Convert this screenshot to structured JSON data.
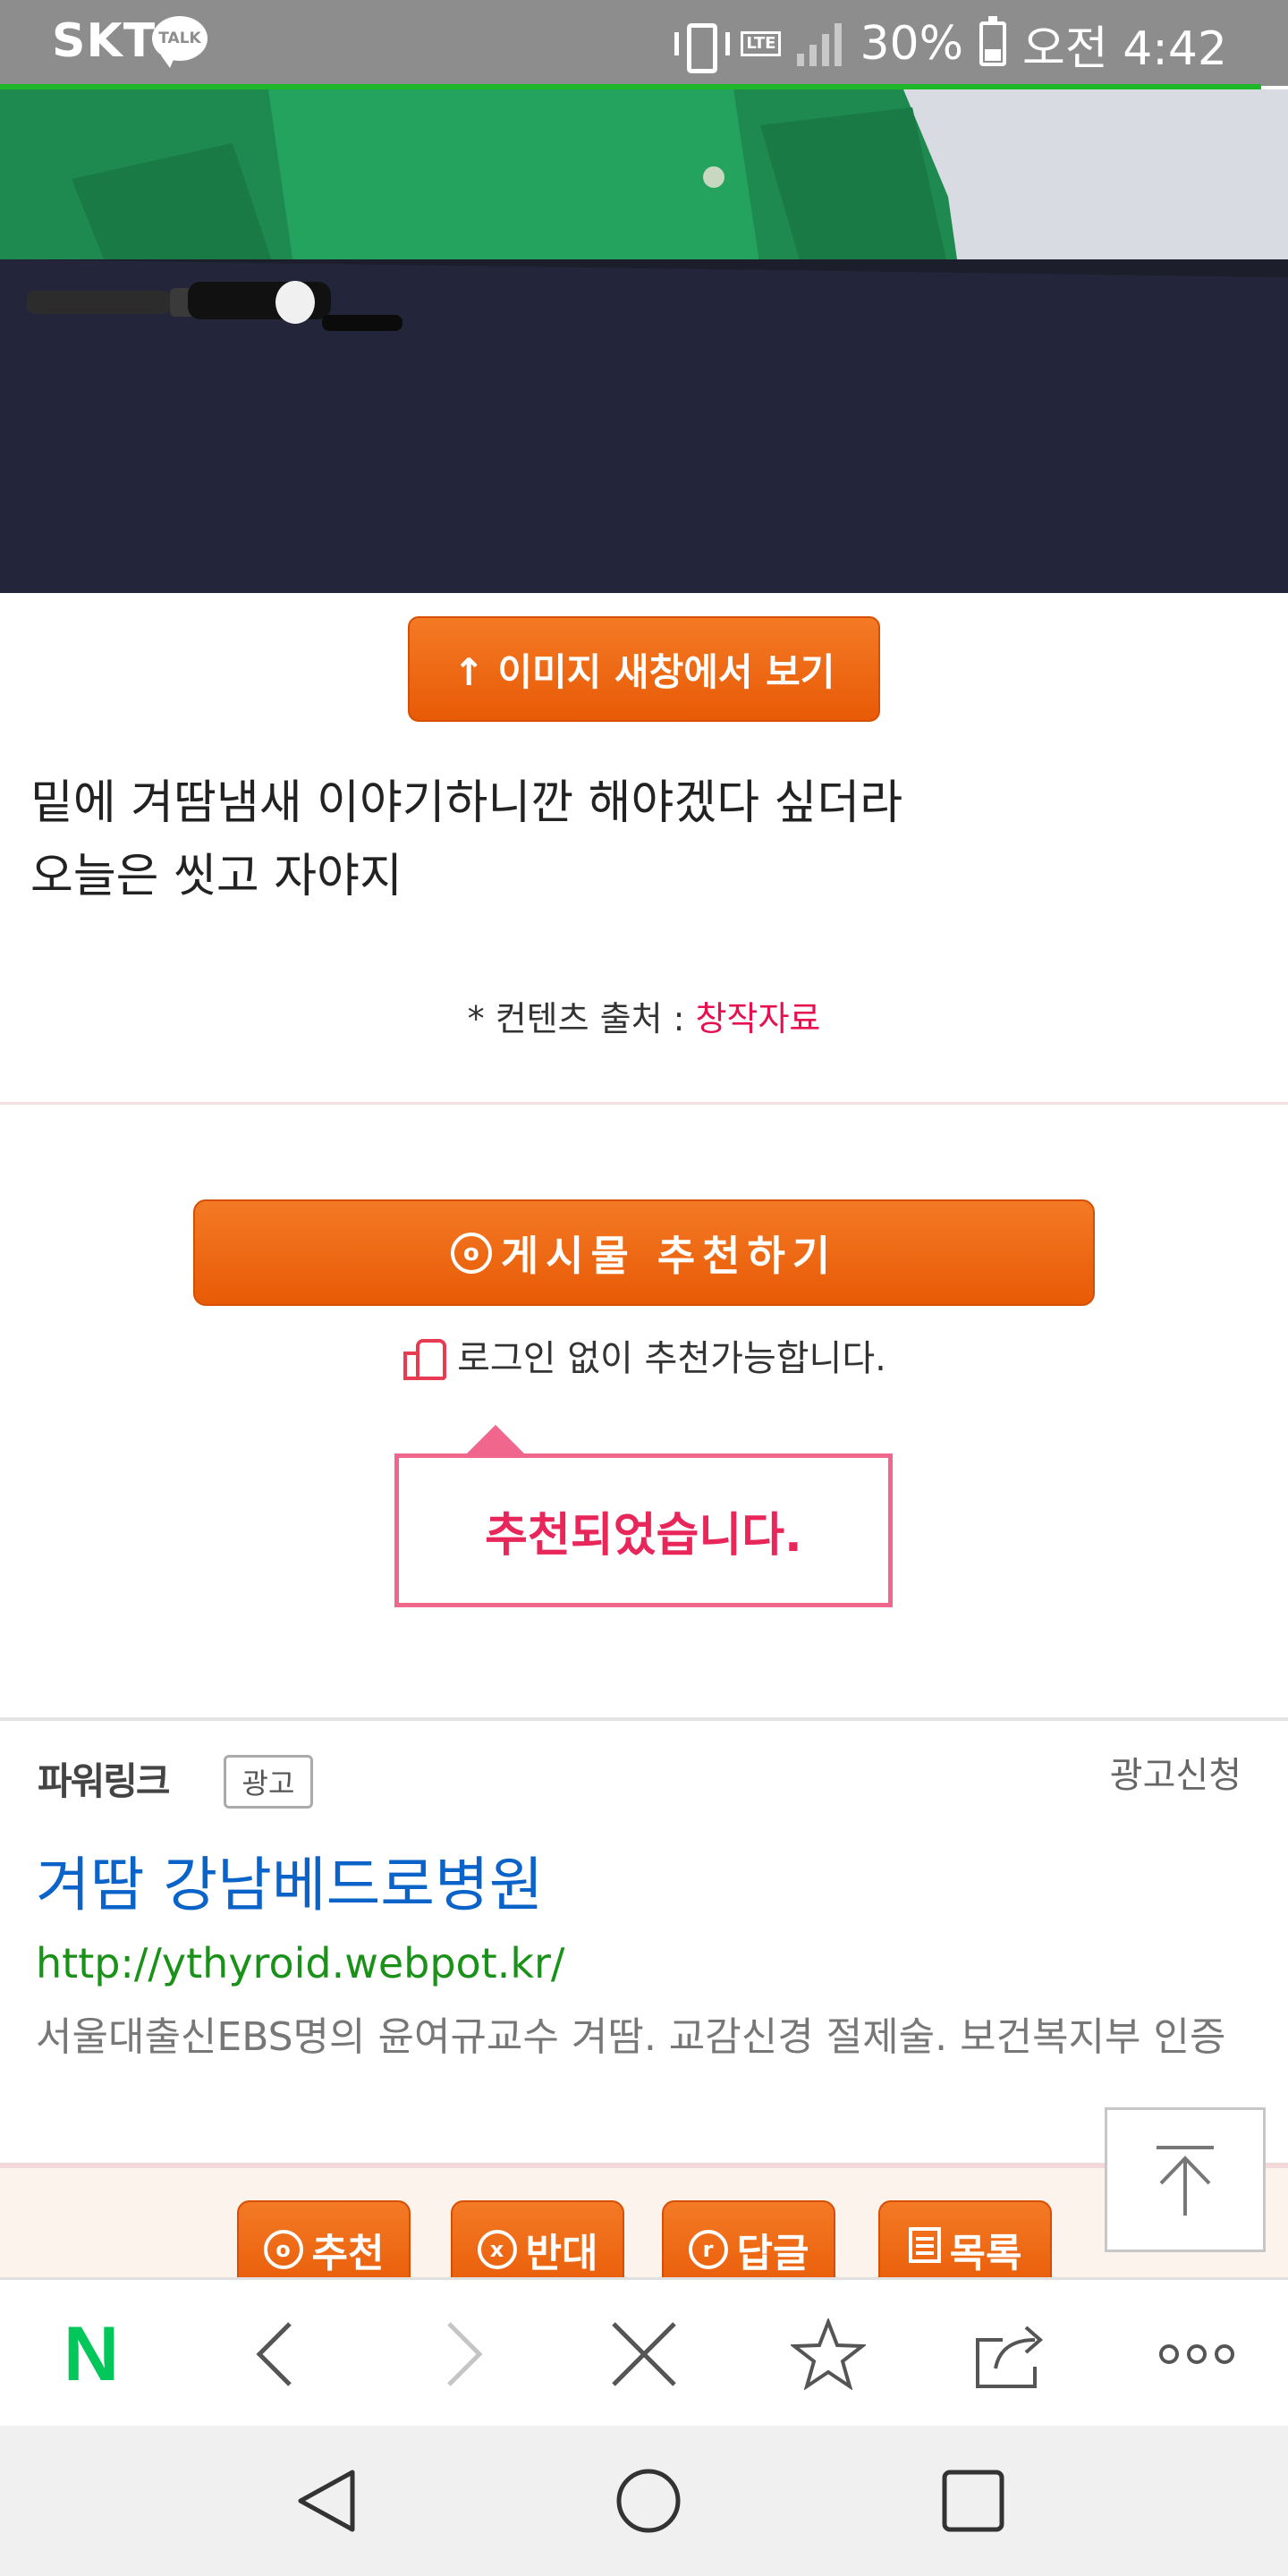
{
  "status_bar": {
    "carrier": "SKT",
    "talk_badge": "TALK",
    "network": "LTE",
    "battery": "30%",
    "time": "오전 4:42"
  },
  "post": {
    "view_image_label": "↑ 이미지 새창에서 보기",
    "body_line1": "밑에 겨땀냄새 이야기하니깐 해야겠다 싶더라",
    "body_line2": "오늘은 씻고 자야지",
    "source_prefix": "* 컨텐츠 출처 : ",
    "source_link": "창작자료"
  },
  "recommend": {
    "button_label": "게시물  추천하기",
    "icon_char": "o",
    "login_note": "로그인 없이 추천가능합니다.",
    "popup_text": "추천되었습니다."
  },
  "ad": {
    "label": "파워링크",
    "badge": "광고",
    "apply": "광고신청",
    "title": "겨땀 강남베드로병원",
    "url": "http://ythyroid.webpot.kr/",
    "description": "서울대출신EBS명의 윤여규교수 겨땀. 교감신경 절제술. 보건복지부 인증"
  },
  "actions": [
    {
      "icon": "o",
      "label": "추천"
    },
    {
      "icon": "x",
      "label": "반대"
    },
    {
      "icon": "r",
      "label": "답글"
    },
    {
      "icon": "list",
      "label": "목록"
    }
  ],
  "browser": {
    "logo": "N",
    "colors": {
      "logo": "#03c75a",
      "accent": "#ec5f07",
      "pink": "#e8265a",
      "ad_title": "#0a63c8",
      "ad_url": "#1a9118"
    }
  }
}
